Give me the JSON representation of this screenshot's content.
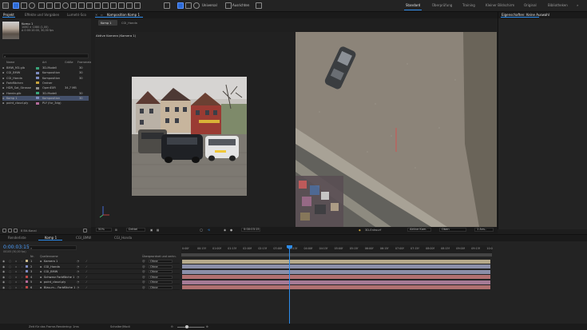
{
  "toolbar": {
    "universal_label": "Universal",
    "align_label": "Ausrichten",
    "workspaces": [
      "Standard",
      "Überprüfung",
      "Training",
      "Kleiner Bildschirm",
      "Original",
      "Bibliotheken"
    ],
    "active_workspace": "Standard"
  },
  "project_panel": {
    "tabs": [
      "Projekt",
      "Effekte und Vorgaben",
      "Lumetri-Sco"
    ],
    "selected_item_name": "Komp 1",
    "selected_item_info_1": "1080 × 1080 (1,00)",
    "selected_item_info_2": "Δ 0:00:10:00, 30,00 fps",
    "columns": [
      "Name",
      "Art",
      "Größe",
      "Framerate"
    ],
    "items": [
      {
        "name": "BMW_M3.glb",
        "type": "3D-Modell",
        "size": "",
        "fps": "30",
        "color": "#3aa57a"
      },
      {
        "name": "CGI_BMW",
        "type": "Komposition",
        "size": "",
        "fps": "30",
        "color": "#7d8bbf"
      },
      {
        "name": "CGI_Honda",
        "type": "Komposition",
        "size": "",
        "fps": "30",
        "color": "#7d8bbf"
      },
      {
        "name": "Farbflächen",
        "type": "Ordner",
        "size": "",
        "fps": "",
        "color": "#c8a33c"
      },
      {
        "name": "HDR_Sat_Strasse",
        "type": "OpenEXR",
        "size": "34,7 MB",
        "fps": "",
        "color": "#8e8e8e"
      },
      {
        "name": "Honda.glb",
        "type": "3D-Modell",
        "size": "",
        "fps": "30",
        "color": "#3aa57a"
      },
      {
        "name": "Komp 1",
        "type": "Komposition",
        "size": "",
        "fps": "30",
        "color": "#7d8bbf"
      },
      {
        "name": "point_cloud.ply",
        "type": "PLY (fur_3dg)",
        "size": "",
        "fps": "",
        "color": "#b36a9a"
      }
    ],
    "bit_depth": "8 Bit-Kanal"
  },
  "comp_panel": {
    "title": "Komposition Komp 1",
    "tabs": [
      "Komp 1",
      "CGI_Honda"
    ],
    "active_camera": "Aktive Kamera (Kamera 1)"
  },
  "comp_footer": {
    "zoom": "50%",
    "resolution": "Drittel",
    "timecode": "0:00:03:15",
    "renderer": "3D-Entwurf",
    "camera_view": "Aktive Kam.",
    "view_mode": "Oben",
    "views": "1 Ans.."
  },
  "properties": {
    "title": "Eigenschaften: Keine Auswahl"
  },
  "timeline": {
    "tabs": [
      "Renderliste",
      "Komp 1",
      "CGI_BMW",
      "CGI_Honda"
    ],
    "active_tab": "Komp 1",
    "current_time": "0:00:03:15",
    "frame_info": "00105 (30,00 fps)",
    "columns": [
      "Nr.",
      "Quellenname",
      "Übergeordnet und verkn."
    ],
    "layers": [
      {
        "num": "1",
        "name": "Kamera 1",
        "parent": "Ohne",
        "color": "#c9b88a"
      },
      {
        "num": "2",
        "name": "CGI_Honda",
        "parent": "Ohne",
        "color": "#7d8bbf"
      },
      {
        "num": "3",
        "name": "CGI_BMW",
        "parent": "Ohne",
        "color": "#7d8bbf"
      },
      {
        "num": "4",
        "name": "Schwarz Farbfläche 1",
        "parent": "Ohne",
        "color": "#c04848"
      },
      {
        "num": "5",
        "name": "point_cloud.ply",
        "parent": "Ohne",
        "color": "#b36a9a"
      },
      {
        "num": "6",
        "name": "Blau-m... Farbfläche 1",
        "parent": "Ohne",
        "color": "#c04848"
      }
    ],
    "ruler_labels": [
      "0:00f",
      "00:15f",
      "01:00f",
      "01:15f",
      "02:00f",
      "02:15f",
      "03:00f",
      "03:15f",
      "04:00f",
      "04:15f",
      "05:00f",
      "05:15f",
      "06:00f",
      "06:15f",
      "07:00f",
      "07:15f",
      "08:00f",
      "08:15f",
      "09:00f",
      "09:15f",
      "10:0"
    ],
    "track_colors": [
      "#b5a98a",
      "#8b8fa8",
      "#8b8fa8",
      "#b07070",
      "#a57a95",
      "#b07070"
    ]
  },
  "statusbar": {
    "render_time": "Zeit für das Frame-Rendering: 1ms",
    "switch_mode": "Schalter/Modi"
  }
}
